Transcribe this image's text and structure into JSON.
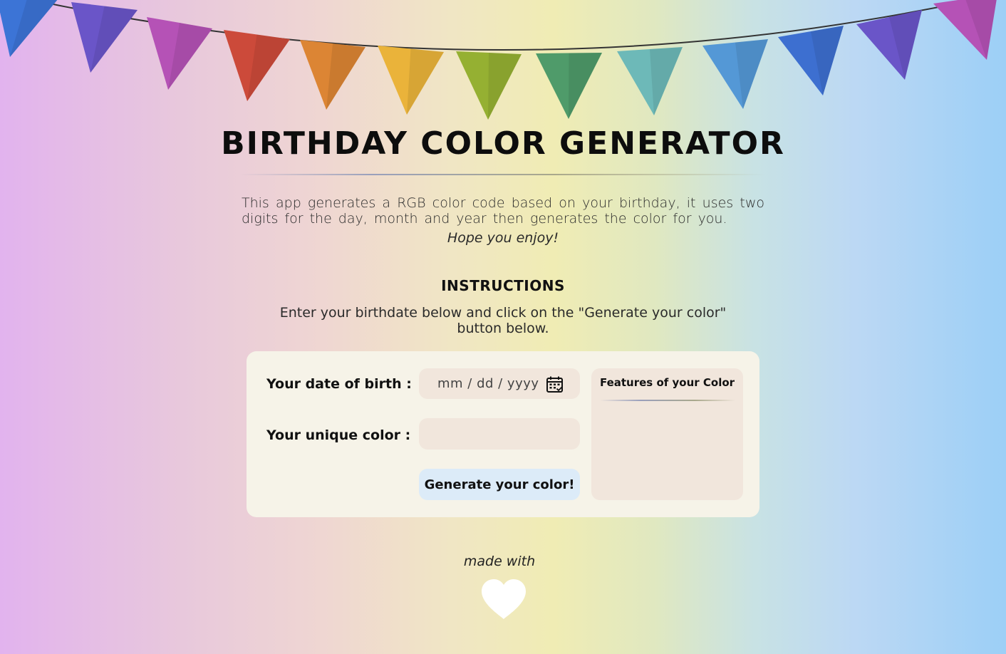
{
  "header": {
    "title": "BIRTHDAY COLOR GENERATOR",
    "bunting_colors": [
      "#3c74d6",
      "#6a55c8",
      "#b552b6",
      "#cc4a3a",
      "#dc8534",
      "#eab33a",
      "#95b032",
      "#4f9b6a",
      "#6db9b8",
      "#5498d6",
      "#3d6fd0",
      "#6a55c8",
      "#b552b6"
    ]
  },
  "intro": {
    "description": "This app generates a RGB color code based on your birthday, it uses two digits for the day, month and year then generates the color for you.",
    "enjoy": "Hope you enjoy!"
  },
  "instructions": {
    "heading": "INSTRUCTIONS",
    "text": "Enter your birthdate below and click on the \"Generate your color\" button below."
  },
  "form": {
    "dob_label": "Your date of birth :",
    "dob_placeholder": "mm / dd / yyyy",
    "color_label": "Your unique color :",
    "color_value": "",
    "generate_button": "Generate your color!",
    "features_title": "Features of your Color"
  },
  "footer": {
    "made_with": "made with",
    "heart_icon": "heart-icon"
  },
  "colors": {
    "card_bg": "#f6f3e8",
    "field_bg": "#f1e6dc",
    "button_bg": "#dcebf8"
  }
}
